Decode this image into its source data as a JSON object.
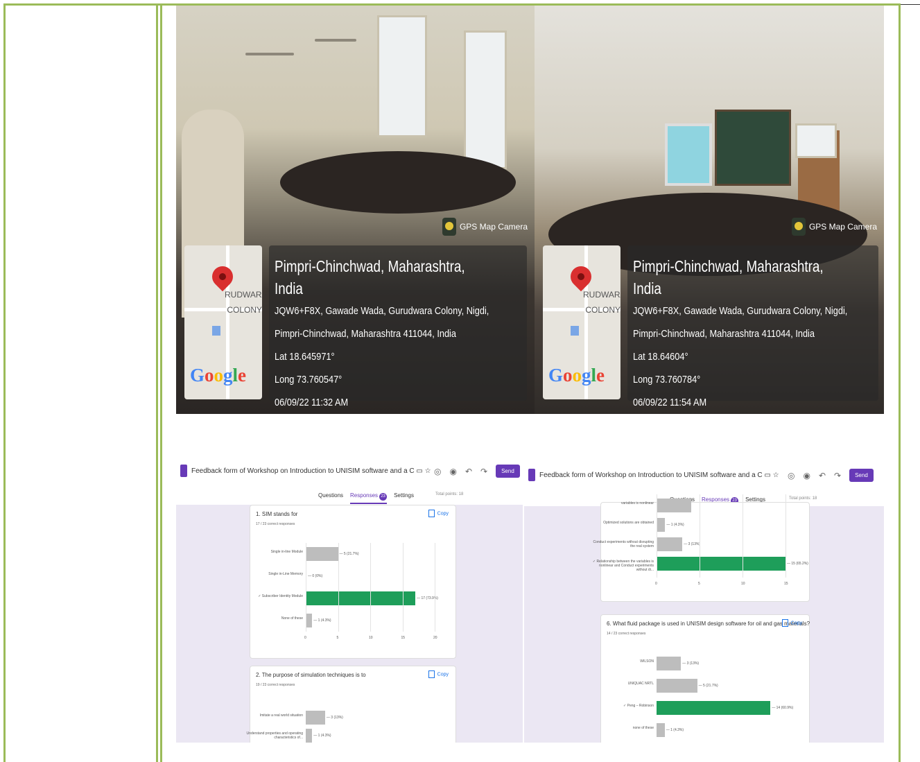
{
  "photos": [
    {
      "title": "Pimpri-Chinchwad, Maharashtra, India",
      "address1": "JQW6+F8X, Gawade Wada, Gurudwara Colony, Nigdi,",
      "address2": "Pimpri-Chinchwad, Maharashtra 411044, India",
      "lat": "Lat 18.645971°",
      "long": "Long 73.760547°",
      "datetime": "06/09/22 11:32 AM",
      "gps_label": "GPS Map Camera",
      "map_label_1": "RUDWARA",
      "map_label_2": "COLONY",
      "google": [
        "G",
        "o",
        "o",
        "g",
        "l",
        "e"
      ]
    },
    {
      "title": "Pimpri-Chinchwad, Maharashtra, India",
      "address1": "JQW6+F8X, Gawade Wada, Gurudwara Colony, Nigdi,",
      "address2": "Pimpri-Chinchwad, Maharashtra 411044, India",
      "lat": "Lat 18.64604°",
      "long": "Long 73.760784°",
      "datetime": "06/09/22 11:54 AM",
      "gps_label": "GPS Map Camera",
      "map_label_1": "RUDWARA",
      "map_label_2": "COLONY",
      "google": [
        "G",
        "o",
        "o",
        "g",
        "l",
        "e"
      ]
    }
  ],
  "forms": [
    {
      "title": "Feedback form of Workshop on Introduction to UNISIM software and a C",
      "tab_questions": "Questions",
      "tab_responses": "Responses",
      "responses_count": "23",
      "tab_settings": "Settings",
      "total_points": "Total points: 18",
      "send_label": "Send"
    },
    {
      "title": "Feedback form of Workshop on Introduction to UNISIM software and a C",
      "tab_questions": "Questions",
      "tab_responses": "Responses",
      "responses_count": "23",
      "tab_settings": "Settings",
      "total_points": "Total points: 18",
      "send_label": "Send"
    }
  ],
  "q1": {
    "title": "1. SIM stands for",
    "summary": "17 / 23 correct responses",
    "copy": "Copy",
    "bars": [
      {
        "label": "Single in-line Module",
        "value": 5,
        "text": "5 (21.7%)",
        "correct": false
      },
      {
        "label": "Single in-Line Memory",
        "value": 0,
        "text": "0 (0%)",
        "correct": false
      },
      {
        "label": "✓ Subscriber Identity Module",
        "value": 17,
        "text": "17 (73.9%)",
        "correct": true
      },
      {
        "label": "None of these",
        "value": 1,
        "text": "1 (4.3%)",
        "correct": false
      }
    ],
    "ticks": [
      "0",
      "5",
      "10",
      "15",
      "20"
    ]
  },
  "q2": {
    "title": "2. The purpose of simulation techniques is to",
    "summary": "19 / 23 correct responses",
    "copy": "Copy",
    "bars": [
      {
        "label": "Imitate a real world situation",
        "value": 3,
        "text": "3 (13%)",
        "correct": false
      },
      {
        "label": "Understand properties and operating characteristics of...",
        "value": 1,
        "text": "1 (4.3%)",
        "correct": false
      }
    ]
  },
  "q5": {
    "bars": [
      {
        "label": "variables is nonlinear",
        "value": 4,
        "text": "",
        "correct": false
      },
      {
        "label": "Optimized solutions are obtained",
        "value": 1,
        "text": "1 (4.3%)",
        "correct": false
      },
      {
        "label": "Conduct experiments without disrupting the real system",
        "value": 3,
        "text": "3 (13%)",
        "correct": false
      },
      {
        "label": "✓ Relationship between the variables is nonlinear and Conduct experiments without di...",
        "value": 15,
        "text": "15 (65.2%)",
        "correct": true
      }
    ],
    "ticks": [
      "0",
      "5",
      "10",
      "15"
    ]
  },
  "q6": {
    "title": "6. What fluid package is used in UNISIM design software for oil and gas materials?",
    "summary": "14 / 23 correct responses",
    "copy": "Copy",
    "bars": [
      {
        "label": "WILSON",
        "value": 3,
        "text": "3 (13%)",
        "correct": false
      },
      {
        "label": "UNIQUAC NRTL",
        "value": 5,
        "text": "5 (21.7%)",
        "correct": false
      },
      {
        "label": "✓ Peng – Robinson",
        "value": 14,
        "text": "14 (60.9%)",
        "correct": true
      },
      {
        "label": "none of these",
        "value": 1,
        "text": "1 (4.3%)",
        "correct": false
      }
    ]
  }
}
